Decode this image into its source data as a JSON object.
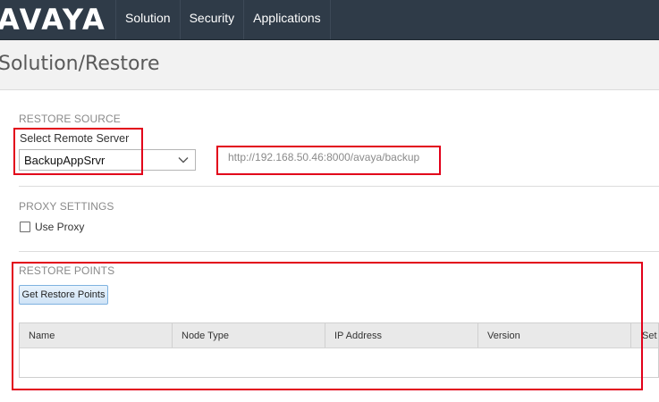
{
  "brand": {
    "logo_text": "AVAYA"
  },
  "nav": {
    "items": [
      {
        "label": "Solution"
      },
      {
        "label": "Security"
      },
      {
        "label": "Applications"
      }
    ]
  },
  "page": {
    "title": "Solution/Restore"
  },
  "restore_source": {
    "section_title": "RESTORE SOURCE",
    "select_label": "Select Remote Server",
    "selected_value": "BackupAppSrvr",
    "url": "http://192.168.50.46:8000/avaya/backup"
  },
  "proxy": {
    "section_title": "PROXY SETTINGS",
    "use_proxy_label": "Use Proxy",
    "use_proxy_checked": false
  },
  "restore_points": {
    "section_title": "RESTORE POINTS",
    "button_label": "Get Restore Points",
    "columns": [
      "Name",
      "Node Type",
      "IP Address",
      "Version",
      "Set"
    ],
    "rows": []
  },
  "colors": {
    "topbar": "#2f3b48",
    "highlight": "#e2001a",
    "button_border": "#7fb2e0"
  }
}
